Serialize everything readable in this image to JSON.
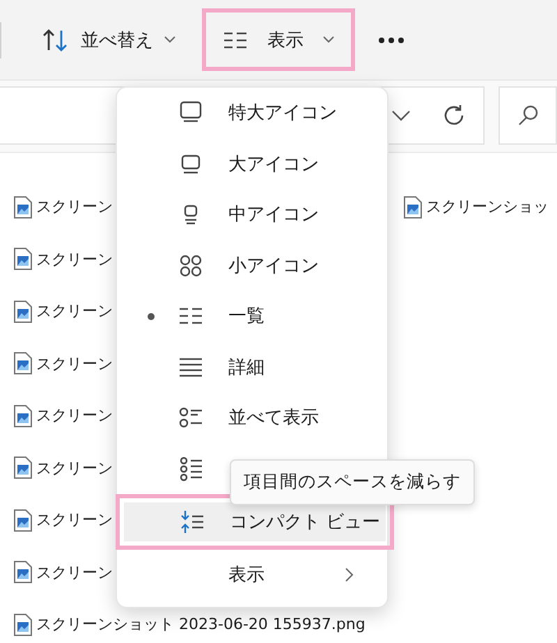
{
  "toolbar": {
    "buttons": [
      {
        "label": "並べ替え",
        "highlighted": false
      },
      {
        "label": "表示",
        "highlighted": true
      }
    ]
  },
  "files": {
    "left": [
      "スクリーン",
      "スクリーン",
      "スクリーン",
      "スクリーン",
      "スクリーン",
      "スクリーン",
      "スクリーン",
      "スクリーン",
      "スクリーンショット 2023-06-20 155937.png"
    ],
    "right": [
      "スクリーンショッ"
    ]
  },
  "view_menu": {
    "items": [
      {
        "kind": "option",
        "label": "特大アイコン",
        "selected": false,
        "hovered": false,
        "highlighted": false
      },
      {
        "kind": "option",
        "label": "大アイコン",
        "selected": false,
        "hovered": false,
        "highlighted": false
      },
      {
        "kind": "option",
        "label": "中アイコン",
        "selected": false,
        "hovered": false,
        "highlighted": false
      },
      {
        "kind": "option",
        "label": "小アイコン",
        "selected": false,
        "hovered": false,
        "highlighted": false
      },
      {
        "kind": "option",
        "label": "一覧",
        "selected": true,
        "hovered": false,
        "highlighted": false
      },
      {
        "kind": "option",
        "label": "詳細",
        "selected": false,
        "hovered": false,
        "highlighted": false
      },
      {
        "kind": "option",
        "label": "並べて表示",
        "selected": false,
        "hovered": false,
        "highlighted": false
      },
      {
        "kind": "option",
        "selected": false,
        "hovered": false,
        "highlighted": false
      },
      {
        "kind": "option",
        "label": "コンパクト ビュー",
        "selected": false,
        "hovered": true,
        "highlighted": true
      },
      {
        "kind": "submenu",
        "label": "表示"
      }
    ]
  },
  "tooltip": "項目間のスペースを減らす"
}
